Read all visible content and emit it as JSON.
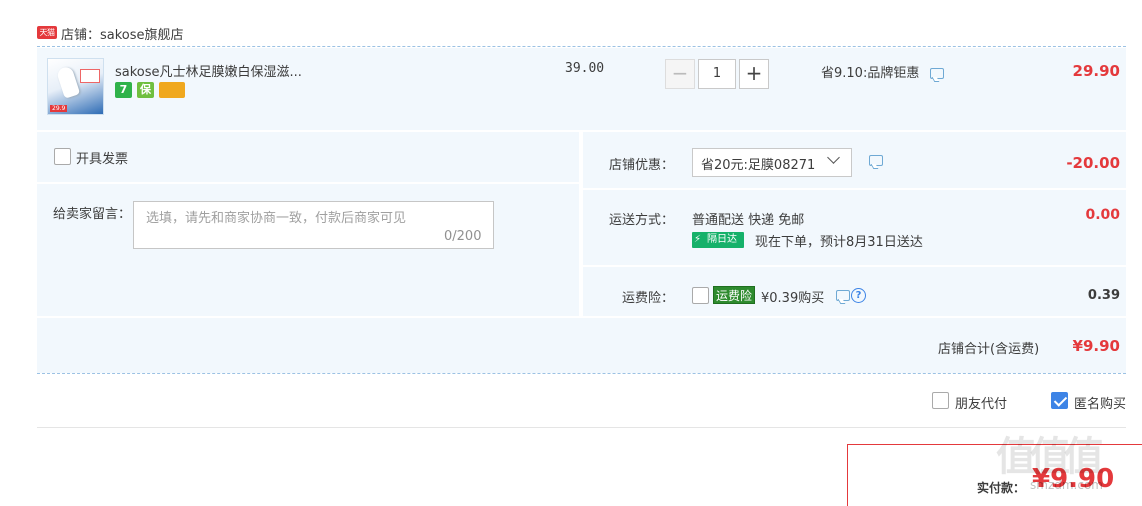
{
  "shop": {
    "badge": "天猫",
    "name": "店铺：sakose旗舰店"
  },
  "item": {
    "thumb_tag": "29.9",
    "title": "sakose凡士林足膜嫩白保湿滋...",
    "service_icons": [
      {
        "name": "seven-day-return-icon",
        "text": "7",
        "color": "#2fb24a"
      },
      {
        "name": "guarantee-icon",
        "text": "保",
        "color": "#6fbf3f"
      },
      {
        "name": "card-payment-icon",
        "text": "",
        "color": "#f0a81e"
      }
    ],
    "unit_price": "39.00",
    "quantity": "1",
    "minus": "−",
    "plus": "+",
    "promo": "省9.10:品牌钜惠",
    "total": "29.90"
  },
  "invoice": {
    "label": "开具发票",
    "checked": false
  },
  "message": {
    "label": "给卖家留言：",
    "placeholder": "选填，请先和商家协商一致，付款后商家可见",
    "count": "0/200"
  },
  "coupon": {
    "label": "店铺优惠：",
    "selected": "省20元:足膜08271",
    "amount": "-20.00"
  },
  "shipping": {
    "label": "运送方式：",
    "method": "普通配送 快递 免邮",
    "badge": "隔日达",
    "eta": "现在下单，预计8月31日送达",
    "amount": "0.00"
  },
  "insurance": {
    "label": "运费险：",
    "badge": "运费险",
    "price": "¥0.39购买",
    "help": "?",
    "amount": "0.39"
  },
  "shop_total": {
    "label": "店铺合计(含运费)",
    "amount": "¥9.90"
  },
  "options": {
    "friend_pay": "朋友代付",
    "friend_pay_checked": false,
    "anonymous": "匿名购买",
    "anonymous_checked": true
  },
  "pay": {
    "label": "实付款：",
    "amount": "¥9.90"
  },
  "watermark": {
    "text": "值值值",
    "url": "smzdm.com"
  },
  "colors": {
    "accent_red": "#e4393c",
    "light_blue_bg": "#f2f8fd",
    "check_blue": "#3d84e6",
    "badge_green": "#16b16a"
  }
}
